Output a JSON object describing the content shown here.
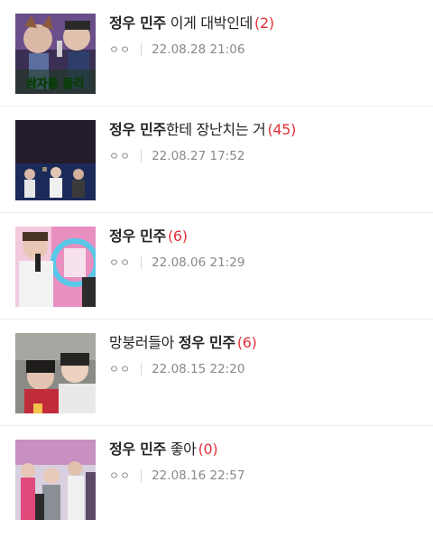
{
  "posts": [
    {
      "pre": "",
      "keyword": "정우 민주",
      "post": " 이게 대박인데",
      "count": "(2)",
      "views": "ㅇㅇ",
      "date": "22.08.28 21:06",
      "thumb_caption": "쌈자를 돌리"
    },
    {
      "pre": "",
      "keyword": "정우 민주",
      "post": "한테 장난치는 거",
      "count": "(45)",
      "views": "ㅇㅇ",
      "date": "22.08.27 17:52",
      "thumb_caption": ""
    },
    {
      "pre": "",
      "keyword": "정우 민주",
      "post": "",
      "count": "(6)",
      "views": "ㅇㅇ",
      "date": "22.08.06 21:29",
      "thumb_caption": ""
    },
    {
      "pre": "망붕러들아 ",
      "keyword": "정우 민주",
      "post": "",
      "count": "(6)",
      "views": "ㅇㅇ",
      "date": "22.08.15 22:20",
      "thumb_caption": ""
    },
    {
      "pre": "",
      "keyword": "정우 민주",
      "post": " 좋아",
      "count": "(0)",
      "views": "ㅇㅇ",
      "date": "22.08.16 22:57",
      "thumb_caption": ""
    }
  ],
  "colors": {
    "count": "#e0313b",
    "meta": "#888888",
    "divider": "#ececec"
  }
}
